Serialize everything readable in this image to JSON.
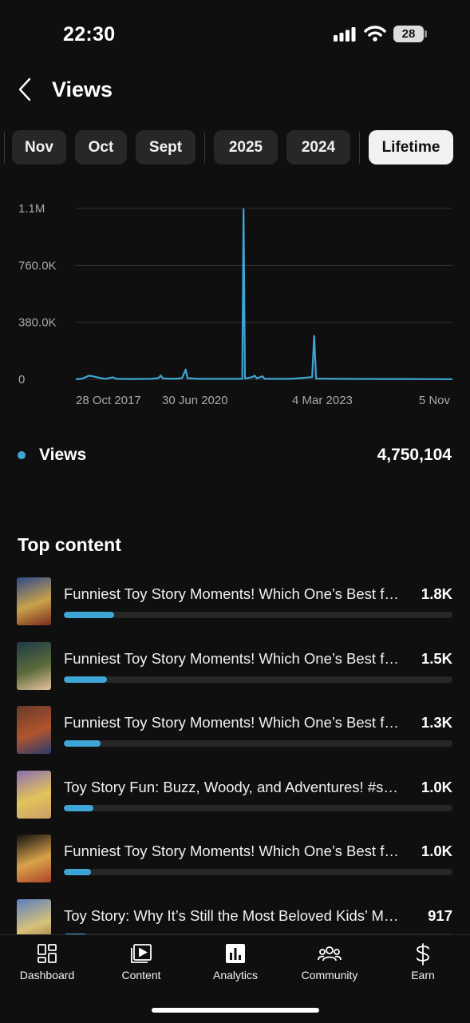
{
  "status_bar": {
    "time": "22:30",
    "battery": "28"
  },
  "header": {
    "title": "Views"
  },
  "period_chips": [
    {
      "label": "Nov",
      "selected": false
    },
    {
      "label": "Oct",
      "selected": false
    },
    {
      "label": "Sept",
      "selected": false
    },
    {
      "label": "2025",
      "selected": false
    },
    {
      "label": "2024",
      "selected": false
    },
    {
      "label": "Lifetime",
      "selected": true
    }
  ],
  "chart_data": {
    "type": "line",
    "title": "",
    "xlabel": "",
    "ylabel": "",
    "y_ticks": [
      "1.1M",
      "760.0K",
      "380.0K",
      "0"
    ],
    "x_ticks": [
      "28 Oct 2017",
      "30 Jun 2020",
      "4 Mar 2023",
      "5 Nov"
    ],
    "x_range": [
      "2017-10-28",
      "2025-11-05"
    ],
    "ylim": [
      0,
      1140000
    ],
    "grid": true,
    "series": [
      {
        "color": "#3ea6d6",
        "points": [
          [
            "2017-10-28",
            0
          ],
          [
            "2017-12-15",
            5000
          ],
          [
            "2018-02-10",
            25000
          ],
          [
            "2018-03-20",
            18000
          ],
          [
            "2018-05-01",
            10000
          ],
          [
            "2018-06-15",
            3000
          ],
          [
            "2018-08-10",
            14000
          ],
          [
            "2018-09-10",
            3000
          ],
          [
            "2019-01-01",
            2000
          ],
          [
            "2019-06-01",
            3000
          ],
          [
            "2019-08-01",
            8000
          ],
          [
            "2019-08-20",
            25000
          ],
          [
            "2019-09-05",
            6000
          ],
          [
            "2019-12-01",
            3000
          ],
          [
            "2020-02-01",
            8000
          ],
          [
            "2020-03-01",
            65000
          ],
          [
            "2020-03-15",
            8000
          ],
          [
            "2020-06-01",
            3000
          ],
          [
            "2020-12-01",
            3000
          ],
          [
            "2021-05-15",
            3000
          ],
          [
            "2021-05-25",
            1135000
          ],
          [
            "2021-06-05",
            5000
          ],
          [
            "2021-08-01",
            15000
          ],
          [
            "2021-08-20",
            25000
          ],
          [
            "2021-09-05",
            6000
          ],
          [
            "2021-10-20",
            20000
          ],
          [
            "2021-11-05",
            3000
          ],
          [
            "2022-06-01",
            3000
          ],
          [
            "2022-11-10",
            15000
          ],
          [
            "2022-11-25",
            290000
          ],
          [
            "2022-12-10",
            5000
          ],
          [
            "2023-06-01",
            3000
          ],
          [
            "2024-06-01",
            2000
          ],
          [
            "2025-11-05",
            1000
          ]
        ]
      }
    ]
  },
  "summary": {
    "label": "Views",
    "value": "4,750,104",
    "color": "#3ea6d6"
  },
  "top_content": {
    "title": "Top content",
    "items": [
      {
        "title": "Funniest Toy Story Moments! Which One’s Best for You? #shorts #toystory #toystory2 #disney #pixar",
        "count": "1.8K",
        "share": 0.13,
        "thumb_colors": [
          "#2f4a8c",
          "#c9a24a",
          "#7b2b1e"
        ]
      },
      {
        "title": "Funniest Toy Story Moments! Which One’s Best for You? #shorts #toystory #buzzlightyear",
        "count": "1.5K",
        "share": 0.11,
        "thumb_colors": [
          "#1d3b46",
          "#5b6b3a",
          "#e8c3a0"
        ]
      },
      {
        "title": "Funniest Toy Story Moments! Which One’s Best for You? #shorts #toystory #woody",
        "count": "1.3K",
        "share": 0.095,
        "thumb_colors": [
          "#6a3a2a",
          "#b0552e",
          "#2b3a6e"
        ]
      },
      {
        "title": "Toy Story Fun: Buzz, Woody, and Adventures! #shorts #toystory #woody #buzz",
        "count": "1.0K",
        "share": 0.075,
        "thumb_colors": [
          "#8a6fb4",
          "#e3c35a",
          "#c9a06a"
        ]
      },
      {
        "title": "Funniest Toy Story Moments! Which One’s Best for You? #shorts #toystory #jessie",
        "count": "1.0K",
        "share": 0.07,
        "thumb_colors": [
          "#111111",
          "#d9a24a",
          "#b0442b"
        ]
      },
      {
        "title": "Toy Story: Why It’s Still the Most Beloved Kids’ Movie #shorts #toystory",
        "count": "917",
        "share": 0.06,
        "thumb_colors": [
          "#5a7fc0",
          "#d8c27a",
          "#8a6a3a"
        ]
      }
    ]
  },
  "tab_bar": {
    "tabs": [
      {
        "label": "Dashboard",
        "icon": "dashboard-icon"
      },
      {
        "label": "Content",
        "icon": "content-icon"
      },
      {
        "label": "Analytics",
        "icon": "analytics-icon"
      },
      {
        "label": "Community",
        "icon": "community-icon"
      },
      {
        "label": "Earn",
        "icon": "earn-icon"
      }
    ]
  }
}
